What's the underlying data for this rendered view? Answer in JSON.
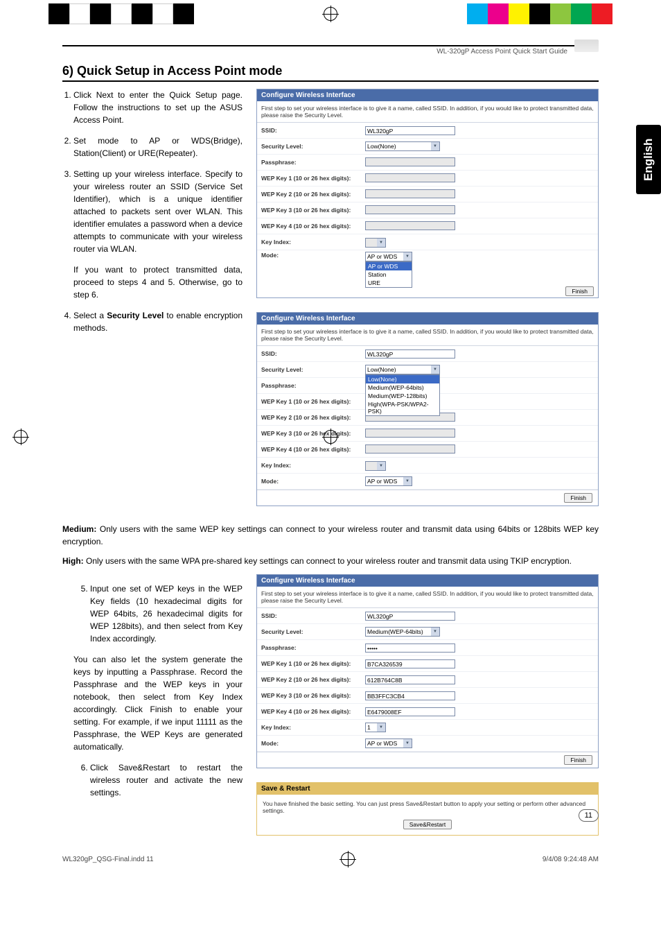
{
  "header": {
    "product": "WL-320gP Access Point Quick Start Guide"
  },
  "tab_label": "English",
  "section_title": "6) Quick Setup in Access Point mode",
  "steps": {
    "s1": "Click Next to enter the Quick Setup page. Follow the instructions to set up the ASUS Access Point.",
    "s2": "Set mode to AP or WDS(Bridge), Station(Client) or URE(Repeater).",
    "s3": "Setting up your wireless interface. Specify to your wireless router an SSID (Service Set Identifier), which is a unique identifier attached to packets sent over WLAN. This identifier emulates a password when a device attempts to communicate with your wireless router via WLAN.",
    "s3_extra": "If you want to protect transmitted data, proceed to steps 4 and 5. Otherwise, go to step 6.",
    "s4_pre": "Select a ",
    "s4_bold": "Security Level",
    "s4_post": " to enable encryption methods.",
    "medium_lbl": "Medium:",
    "medium_text": " Only users with the same WEP key settings can connect to your wireless router and transmit data using 64bits or 128bits WEP key encryption.",
    "high_lbl": "High:",
    "high_text": " Only users with the same WPA pre-shared key settings can connect to your wireless router and transmit data using TKIP encryption.",
    "s5": "Input one set of WEP keys in the WEP Key fields (10 hexadecimal digits for WEP 64bits, 26 hexadecimal digits for WEP 128bits), and then select from Key Index accordingly.",
    "s5_extra": "You can also let the system generate the keys by inputting a Passphrase. Record the Passphrase and the WEP keys in your notebook, then select from Key Index accordingly. Click Finish to enable your setting. For example, if we input 11111 as the Passphrase, the WEP Keys are generated automatically.",
    "s6": "Click Save&Restart to restart the wireless router and activate the new settings."
  },
  "panel_labels": {
    "title": "Configure Wireless Interface",
    "desc": "First step to set your wireless interface is to give it a name, called SSID. In addition, if you would like to protect transmitted data, please raise the Security Level.",
    "ssid": "SSID:",
    "seclevel": "Security Level:",
    "passphrase": "Passphrase:",
    "wep1": "WEP Key 1 (10 or 26 hex digits):",
    "wep2": "WEP Key 2 (10 or 26 hex digits):",
    "wep3": "WEP Key 3 (10 or 26 hex digits):",
    "wep4": "WEP Key 4 (10 or 26 hex digits):",
    "keyidx": "Key Index:",
    "mode": "Mode:",
    "finish": "Finish"
  },
  "panel1": {
    "ssid_val": "WL320gP",
    "sec_val": "Low(None)",
    "mode_val": "AP or WDS",
    "mode_options": [
      "AP or WDS",
      "Station",
      "URE"
    ]
  },
  "panel2": {
    "ssid_val": "WL320gP",
    "sec_val": "Low(None)",
    "sec_options": [
      "Low(None)",
      "Medium(WEP-64bits)",
      "Medium(WEP-128bits)",
      "High(WPA-PSK/WPA2-PSK)"
    ],
    "mode_val": "AP or WDS"
  },
  "panel3": {
    "ssid_val": "WL320gP",
    "sec_val": "Medium(WEP-64bits)",
    "passphrase_val": "•••••",
    "wep1_val": "B7CA326539",
    "wep2_val": "612B764C8B",
    "wep3_val": "BB3FFC3CB4",
    "wep4_val": "E6479008EF",
    "keyidx_val": "1",
    "mode_val": "AP or WDS"
  },
  "save_panel": {
    "title": "Save & Restart",
    "desc": "You have finished the basic setting. You can just press Save&Restart button to apply your setting or perform other advanced settings.",
    "btn": "Save&Restart"
  },
  "page_number": "11",
  "footer": {
    "file": "WL320gP_QSG-Final.indd   11",
    "datetime": "9/4/08   9:24:48 AM"
  },
  "print_colors_left": [
    "#000",
    "#fff",
    "#000",
    "#fff",
    "#000",
    "#fff",
    "#000"
  ],
  "print_colors_right": [
    "#00aeef",
    "#ec008c",
    "#fff200",
    "#000",
    "#8dc63f",
    "#00a651",
    "#ed1c24"
  ]
}
